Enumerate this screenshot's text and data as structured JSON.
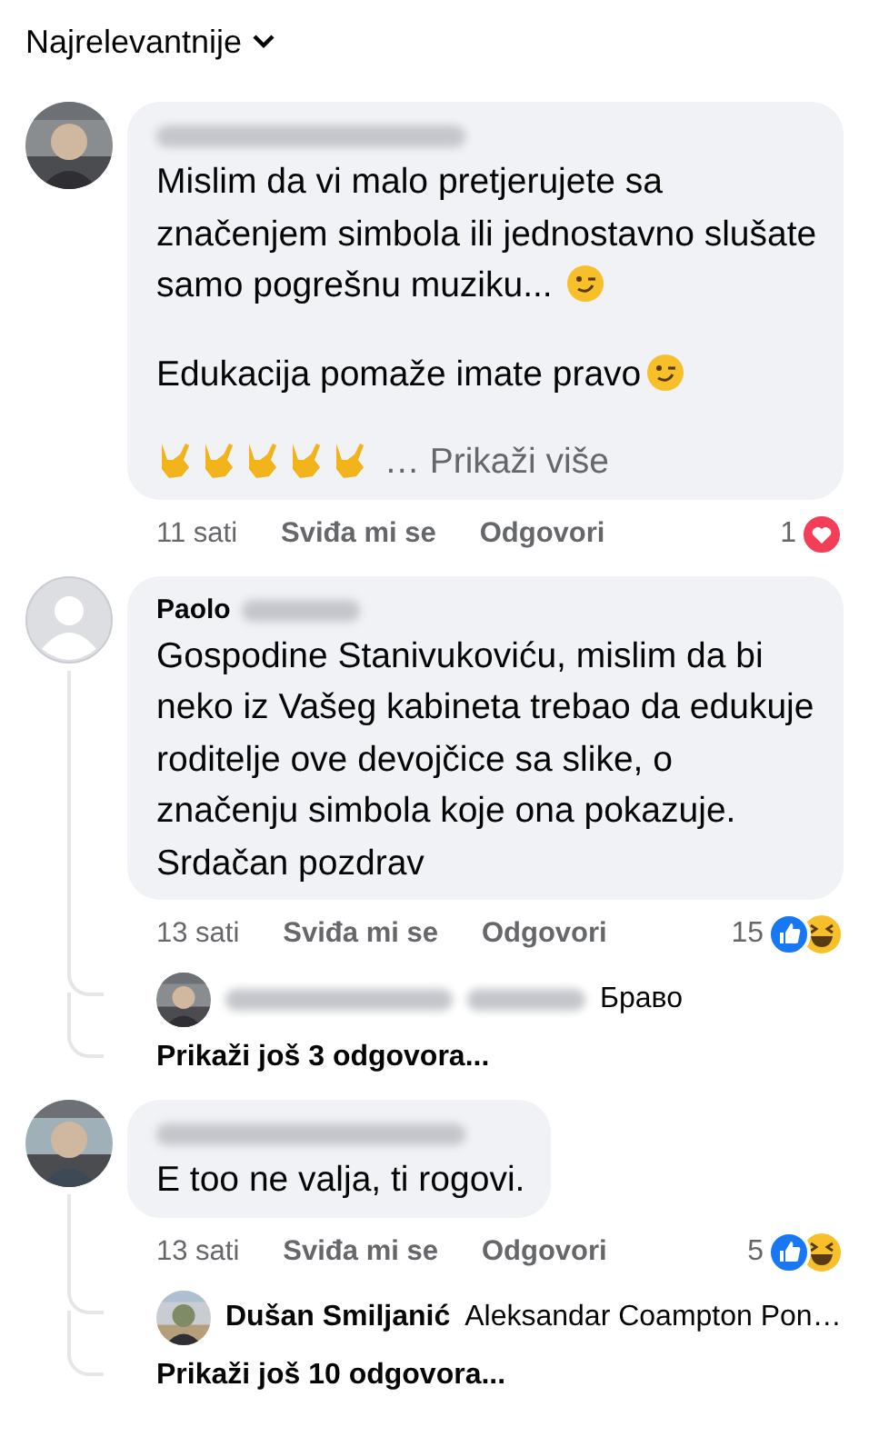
{
  "sort": {
    "label": "Najrelevantnije"
  },
  "comments": [
    {
      "avatar": {
        "kind": "picture"
      },
      "author": [
        {
          "kind": "blur"
        }
      ],
      "paragraphs": [
        [
          {
            "kind": "text",
            "text": "Mislim da vi malo pretjerujete sa značenjem simbola ili jednostavno slušate samo pogrešnu muziku... "
          },
          {
            "kind": "wink"
          }
        ],
        [
          {
            "kind": "text",
            "text": "Edukacija pomaže imate pravo"
          },
          {
            "kind": "wink"
          }
        ],
        [
          {
            "kind": "horns"
          },
          {
            "kind": "horns"
          },
          {
            "kind": "horns"
          },
          {
            "kind": "horns"
          },
          {
            "kind": "horns"
          },
          {
            "kind": "more",
            "text": " … Prikaži više"
          }
        ]
      ],
      "time": "11 sati",
      "like": "Sviđa mi se",
      "reply": "Odgovori",
      "reaction_count": "1",
      "reactions": [
        {
          "kind": "love"
        }
      ]
    },
    {
      "avatar": {
        "kind": "default"
      },
      "author": [
        {
          "kind": "text",
          "text": "Paolo"
        },
        {
          "kind": "blur"
        }
      ],
      "paragraphs": [
        [
          {
            "kind": "text",
            "text": "Gospodine Stanivukoviću, mislim da bi neko iz Vašeg kabineta trebao da edukuje roditelje ove devojčice sa slike, o značenju simbola koje ona pokazuje. Srdačan pozdrav"
          }
        ]
      ],
      "time": "13 sati",
      "like": "Sviđa mi se",
      "reply": "Odgovori",
      "reaction_count": "15",
      "reactions": [
        {
          "kind": "like"
        },
        {
          "kind": "haha"
        }
      ],
      "replies": [
        {
          "author": [
            {
              "kind": "blur"
            },
            {
              "kind": "blur"
            }
          ],
          "text": "Браво"
        }
      ],
      "more_replies": "Prikaži još 3 odgovora..."
    },
    {
      "avatar": {
        "kind": "picture"
      },
      "author": [
        {
          "kind": "blur"
        }
      ],
      "paragraphs": [
        [
          {
            "kind": "text",
            "text": "E too ne valja, ti rogovi."
          }
        ]
      ],
      "time": "13 sati",
      "like": "Sviđa mi se",
      "reply": "Odgovori",
      "reaction_count": "5",
      "reactions": [
        {
          "kind": "like"
        },
        {
          "kind": "haha"
        }
      ],
      "replies": [
        {
          "author": [
            {
              "kind": "text",
              "text": "Dušan Smiljanić"
            }
          ],
          "text": "Aleksandar Coampton Pon…"
        }
      ],
      "more_replies": "Prikaži još 10 odgovora..."
    }
  ]
}
